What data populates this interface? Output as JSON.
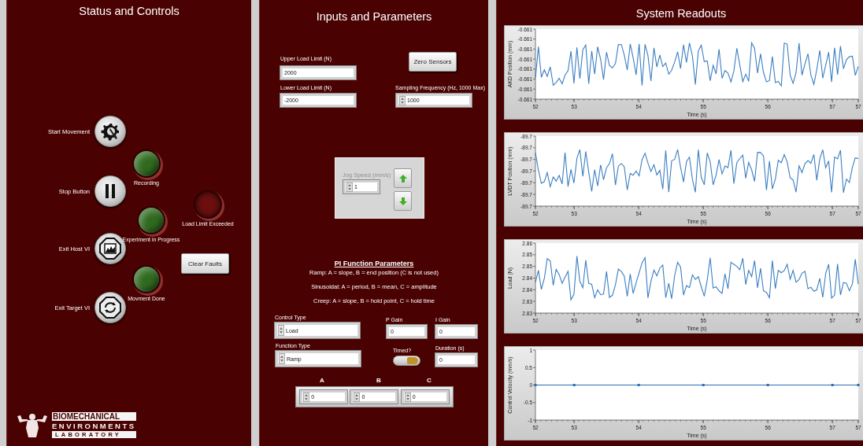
{
  "status_panel": {
    "title": "Status and Controls",
    "buttons": [
      {
        "kind": "start",
        "label": "Start Movement"
      },
      {
        "kind": "stop",
        "label": "Stop Button"
      },
      {
        "kind": "exit-host",
        "label": "Exit Host VI"
      },
      {
        "kind": "exit-target",
        "label": "Exit Target VI"
      }
    ],
    "leds": [
      {
        "label": "Recording",
        "on": true,
        "color": "#2f6a1e"
      },
      {
        "label": "Experiment in Progress",
        "on": true,
        "color": "#2f6a1e"
      },
      {
        "label": "Movment Done",
        "on": true,
        "color": "#2f6a1e"
      },
      {
        "label": "Load Limit Exceeded",
        "on": false,
        "color": "#6e0f0f"
      }
    ],
    "clear_button": "Clear Faults",
    "logo": {
      "lines": [
        "BIOMECHANICAL",
        "ENVIRONMENTS",
        "LABORATORY"
      ]
    }
  },
  "inputs_panel": {
    "title": "Inputs and Parameters",
    "upper_limit": {
      "label": "Upper Load Limit (N)",
      "value": "2000"
    },
    "lower_limit": {
      "label": "Lower Load Limit (N)",
      "value": "-2000"
    },
    "zero_button": "Zero Sensors",
    "sampling": {
      "label": "Sampling Frequency (Hz, 1000 Max)",
      "value": "1000"
    },
    "jog": {
      "label": "Jog Speed (mm/s)",
      "value": "1"
    },
    "pi_header": "PI Function Parameters",
    "pi_notes": [
      "Ramp: A = slope, B = end position (C is not used)",
      "Sinusoidal: A = period, B = mean, C = amplitude",
      "Creep: A = slope, B = hold point, C = hold time"
    ],
    "control_type": {
      "label": "Control Type",
      "value": "Load"
    },
    "function_type": {
      "label": "Function Type",
      "value": "Ramp"
    },
    "p_gain": {
      "label": "P Gain",
      "value": "0"
    },
    "i_gain": {
      "label": "I Gain",
      "value": "0"
    },
    "timed": {
      "label": "Timed?",
      "on": true
    },
    "duration": {
      "label": "Duration (s)",
      "value": "0"
    },
    "params": [
      {
        "label": "A",
        "value": "0"
      },
      {
        "label": "B",
        "value": "0"
      },
      {
        "label": "C",
        "value": "0"
      }
    ]
  },
  "readouts_panel": {
    "title": "System Readouts",
    "traces": [
      {
        "ylabel": "AKD Position (mm)",
        "xlabel": "Time (s)",
        "yticks": [
          "-0.661",
          "-0.661",
          "-0.661",
          "-0.661",
          "-0.661",
          "-0.661",
          "-0.661",
          "-0.661"
        ],
        "xticks": [
          "52",
          "53",
          "54",
          "55",
          "56",
          "57",
          "57"
        ]
      },
      {
        "ylabel": "LVDT Position (mm)",
        "xlabel": "Time (s)",
        "yticks": [
          "-89.7",
          "-89.7",
          "-89.7",
          "-89.7",
          "-89.7",
          "-89.7",
          "-89.7"
        ],
        "xticks": [
          "52",
          "53",
          "54",
          "55",
          "56",
          "57",
          "57"
        ]
      },
      {
        "ylabel": "Load (N)",
        "xlabel": "Time (s)",
        "yticks": [
          "2.86",
          "2.85",
          "2.85",
          "2.84",
          "2.84",
          "2.83",
          "2.83"
        ],
        "xticks": [
          "52",
          "53",
          "54",
          "55",
          "56",
          "57",
          "57"
        ]
      }
    ],
    "velocity": {
      "chart_data": {
        "type": "line",
        "xlabel": "Time (s)",
        "ylabel": "Control Velocity (mm/s)",
        "x": [
          52.4,
          53,
          54,
          55,
          56,
          57,
          57.4
        ],
        "series": [
          {
            "color": "#2a6fb5",
            "marker": "square",
            "values": [
              0,
              0,
              0,
              0,
              0,
              0,
              0
            ]
          }
        ],
        "xlim": [
          52.4,
          57.4
        ],
        "ylim": [
          -1,
          1
        ],
        "xticks": [
          {
            "value": 52.4,
            "label": "52"
          },
          53,
          54,
          55,
          56,
          57,
          {
            "value": 57.4,
            "label": "57"
          }
        ],
        "yticks": [
          {
            "value": 1,
            "label": "1"
          },
          {
            "value": 0.5,
            "label": "0.5"
          },
          {
            "value": 0,
            "label": "0"
          },
          {
            "value": -0.5,
            "label": "-0.5"
          },
          {
            "value": -1,
            "label": "-1"
          }
        ]
      }
    }
  }
}
